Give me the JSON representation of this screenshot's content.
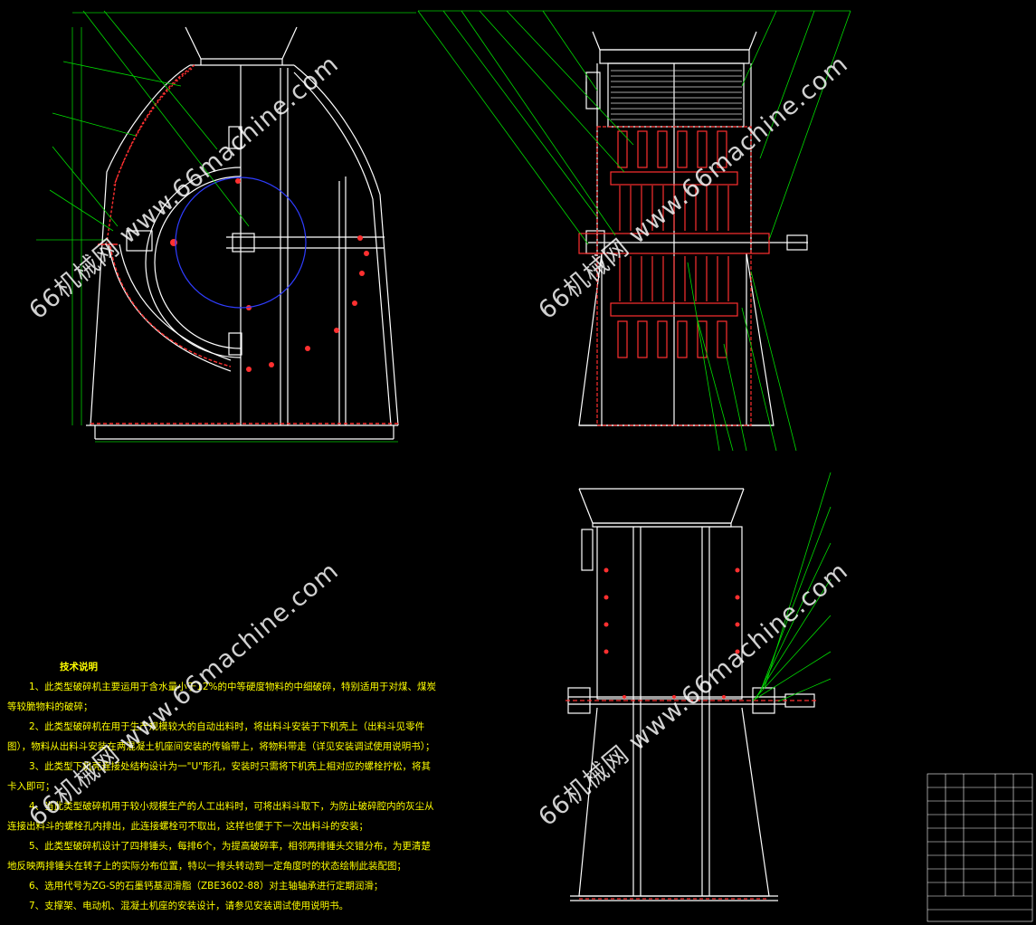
{
  "notes": {
    "title": "技术说明",
    "lines": [
      "1、此类型破碎机主要运用于含水量小于12%的中等硬度物料的中细破碎，特别适用于对煤、煤炭等较脆物料的破碎；",
      "2、此类型破碎机在用于生产规模较大的自动出料时，将出料斗安装于下机壳上（出料斗见零件图），物料从出料斗安装在两混凝土机座间安装的传输带上，将物料带走（详见安装调试使用说明书）；",
      "3、此类型下机壳连接处结构设计为一\"U\"形孔，安装时只需将下机壳上相对应的螺栓拧松，将其卡入即可；",
      "4、当此类型破碎机用于较小规模生产的人工出料时，可将出料斗取下，为防止破碎腔内的灰尘从连接出料斗的螺栓孔内排出，此连接螺栓可不取出，这样也便于下一次出料斗的安装；",
      "5、此类型破碎机设计了四排锤头，每排6个，为提高破碎率，相邻两排锤头交错分布，为更清楚地反映两排锤头在转子上的实际分布位置，特以一排头转动到一定角度时的状态绘制此装配图；",
      "6、选用代号为ZG-S的石墨钙基润滑脂（ZBE3602-88）对主轴轴承进行定期润滑；",
      "7、支撑架、电动机、混凝土机座的安装设计，请参见安装调试使用说明书。"
    ]
  },
  "watermarks": [
    {
      "text": "66机械网 www.66machine.com"
    },
    {
      "text": "66机械网 www.66machine.com"
    },
    {
      "text": "66机械网 www.66machine.com"
    },
    {
      "text": "66机械网 www.66machine.com"
    }
  ],
  "colors": {
    "background": "#000000",
    "outline": "#ffffff",
    "detail": "#ff3030",
    "leader": "#00dd00",
    "circle": "#2f3dff",
    "notes": "#ffff00"
  }
}
